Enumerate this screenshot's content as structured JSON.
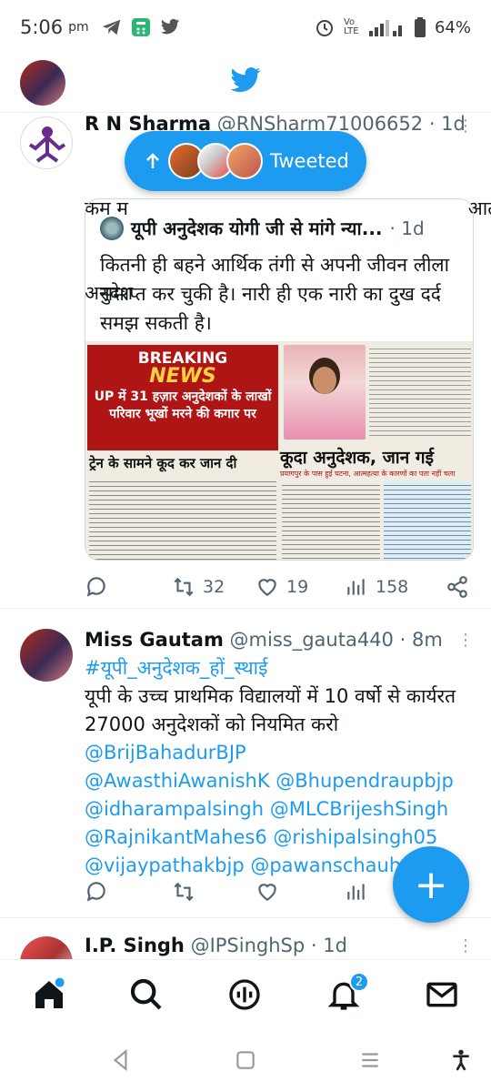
{
  "status_bar": {
    "time": "5:06",
    "ampm": "pm",
    "network_label": "Vo LTE",
    "lte_label": "LTE",
    "battery": "64%"
  },
  "tweets": [
    {
      "name": "R N Sharma",
      "handle": "@RNSharm71006652",
      "time": "· 1d",
      "text_line1": "कम म                                                        आत्महत्या करते",
      "text_line2": "अनुदेश",
      "quote": {
        "title": "यूपी अनुदेशक योगी जी से मांगे न्या...",
        "time": "· 1d",
        "text": "कितनी ही बहने आर्थिक तंगी से अपनी जीवन लीला समाप्त कर चुकी है। नारी ही एक नारी का दुख दर्द समझ सकती है।",
        "np_breaking": "BREAKING",
        "np_news": "NEWS",
        "np_headline": "UP में 31 हज़ार अनुदेशकों के लाखों परिवार भूखों मरने की कगार पर",
        "np_left_headline": "ट्रेन के सामने कूद कर जान दी",
        "np_right_headline": "कूदा अनुदेशक, जान गई",
        "np_right_sub": "प्रयागपुर के पास हुई घटना, आत्महत्या के कारणों का पता नहीं चला"
      },
      "replies": "",
      "retweets": "32",
      "likes": "19",
      "views": "158"
    },
    {
      "name": "Miss Gautam",
      "handle": "@miss_gauta440",
      "time": "· 8m",
      "hashtag": "#यूपी_अनुदेशक_हों_स्थाई",
      "text": "यूपी के उच्च प्राथमिक विद्यालयों में 10 वर्षो से कार्यरत 27000 अनुदेशकों को नियमित करो",
      "mentions": [
        "@BrijBahadurBJP",
        "@AwasthiAwanishK @Bhupendraupbjp",
        "@idharampalsingh @MLCBrijeshSingh",
        "@RajnikantMahes6 @rishipalsingh05",
        "@vijaypathakbjp @pawanschauhan07 ·"
      ]
    },
    {
      "name": "I.P. Singh",
      "handle": "@IPSinghSp",
      "time": "· 1d"
    }
  ],
  "new_tweets_pill": {
    "label": "Tweeted"
  },
  "fab": {
    "label": "+"
  },
  "bottom_nav": {
    "notifications_badge": "2"
  },
  "colors": {
    "accent": "#1d9bf0",
    "text": "#0f1419",
    "muted": "#536471"
  }
}
